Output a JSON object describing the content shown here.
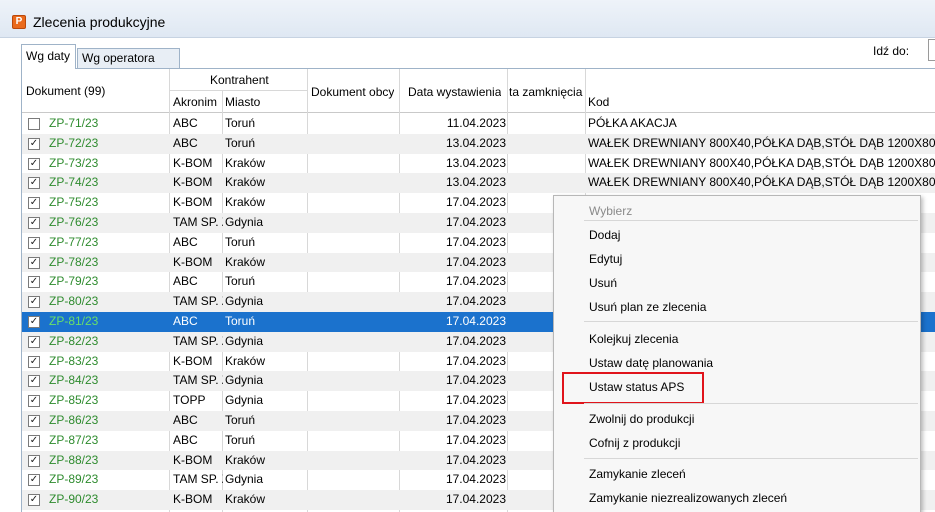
{
  "window": {
    "title": "Zlecenia produkcyjne",
    "app_icon_letter": "P"
  },
  "tabs": [
    {
      "label": "Wg daty",
      "active": true
    },
    {
      "label": "Wg operatora",
      "active": false
    }
  ],
  "goto_label": "Idź do:",
  "headers": {
    "dokument": "Dokument (99)",
    "kontrahent": "Kontrahent",
    "akronim": "Akronim",
    "miasto": "Miasto",
    "dokument_obcy": "Dokument obcy",
    "data_wystawienia": "Data wystawienia",
    "data_zamkniecia": "ta zamknięcia",
    "kod": "Kod"
  },
  "rows": [
    {
      "doc": "ZP-71/23",
      "checked": false,
      "akronim": "ABC",
      "miasto": "Toruń",
      "data": "11.04.2023",
      "kod": "PÓŁKA AKACJA"
    },
    {
      "doc": "ZP-72/23",
      "checked": true,
      "akronim": "ABC",
      "miasto": "Toruń",
      "data": "13.04.2023",
      "kod": "WAŁEK DREWNIANY 800X40,PÓŁKA DĄB,STÓŁ DĄB 1200X800,PÓ"
    },
    {
      "doc": "ZP-73/23",
      "checked": true,
      "akronim": "K-BOM",
      "miasto": "Kraków",
      "data": "13.04.2023",
      "kod": "WAŁEK DREWNIANY 800X40,PÓŁKA DĄB,STÓŁ DĄB 1200X800,PÓ"
    },
    {
      "doc": "ZP-74/23",
      "checked": true,
      "akronim": "K-BOM",
      "miasto": "Kraków",
      "data": "13.04.2023",
      "kod": "WAŁEK DREWNIANY 800X40,PÓŁKA DĄB,STÓŁ DĄB 1200X800,PÓ"
    },
    {
      "doc": "ZP-75/23",
      "checked": true,
      "akronim": "K-BOM",
      "miasto": "Kraków",
      "data": "17.04.2023",
      "kod": ""
    },
    {
      "doc": "ZP-76/23",
      "checked": true,
      "akronim": "TAM SP. Z",
      "miasto": "Gdynia",
      "data": "17.04.2023",
      "kod": ""
    },
    {
      "doc": "ZP-77/23",
      "checked": true,
      "akronim": "ABC",
      "miasto": "Toruń",
      "data": "17.04.2023",
      "kod": ""
    },
    {
      "doc": "ZP-78/23",
      "checked": true,
      "akronim": "K-BOM",
      "miasto": "Kraków",
      "data": "17.04.2023",
      "kod": ""
    },
    {
      "doc": "ZP-79/23",
      "checked": true,
      "akronim": "ABC",
      "miasto": "Toruń",
      "data": "17.04.2023",
      "kod": ""
    },
    {
      "doc": "ZP-80/23",
      "checked": true,
      "akronim": "TAM SP. Z",
      "miasto": "Gdynia",
      "data": "17.04.2023",
      "kod": ""
    },
    {
      "doc": "ZP-81/23",
      "checked": true,
      "akronim": "ABC",
      "miasto": "Toruń",
      "data": "17.04.2023",
      "kod": "",
      "selected": true
    },
    {
      "doc": "ZP-82/23",
      "checked": true,
      "akronim": "TAM SP. Z",
      "miasto": "Gdynia",
      "data": "17.04.2023",
      "kod": ""
    },
    {
      "doc": "ZP-83/23",
      "checked": true,
      "akronim": "K-BOM",
      "miasto": "Kraków",
      "data": "17.04.2023",
      "kod": ""
    },
    {
      "doc": "ZP-84/23",
      "checked": true,
      "akronim": "TAM SP. Z",
      "miasto": "Gdynia",
      "data": "17.04.2023",
      "kod": ""
    },
    {
      "doc": "ZP-85/23",
      "checked": true,
      "akronim": "TOPP",
      "miasto": "Gdynia",
      "data": "17.04.2023",
      "kod": ""
    },
    {
      "doc": "ZP-86/23",
      "checked": true,
      "akronim": "ABC",
      "miasto": "Toruń",
      "data": "17.04.2023",
      "kod": ""
    },
    {
      "doc": "ZP-87/23",
      "checked": true,
      "akronim": "ABC",
      "miasto": "Toruń",
      "data": "17.04.2023",
      "kod": ""
    },
    {
      "doc": "ZP-88/23",
      "checked": true,
      "akronim": "K-BOM",
      "miasto": "Kraków",
      "data": "17.04.2023",
      "kod": ""
    },
    {
      "doc": "ZP-89/23",
      "checked": true,
      "akronim": "TAM SP. Z",
      "miasto": "Gdynia",
      "data": "17.04.2023",
      "kod": "PÓ"
    },
    {
      "doc": "ZP-90/23",
      "checked": true,
      "akronim": "K-BOM",
      "miasto": "Kraków",
      "data": "17.04.2023",
      "kod": ""
    }
  ],
  "context_menu": {
    "header": "Wybierz",
    "items": [
      {
        "label": "Dodaj"
      },
      {
        "label": "Edytuj"
      },
      {
        "label": "Usuń"
      },
      {
        "label": "Usuń plan ze zlecenia"
      },
      {
        "label": "Kolejkuj zlecenia"
      },
      {
        "label": "Ustaw datę planowania"
      },
      {
        "label": "Ustaw status APS",
        "highlighted": true
      },
      {
        "label": "Zwolnij do produkcji"
      },
      {
        "label": "Cofnij z produkcji"
      },
      {
        "label": "Zamykanie zleceń"
      },
      {
        "label": "Zamykanie niezrealizowanych zleceń"
      }
    ]
  },
  "colors": {
    "selected_row": "#1b72cd",
    "doc_text": "#2e8b2e",
    "highlight_box": "#e0141b"
  }
}
